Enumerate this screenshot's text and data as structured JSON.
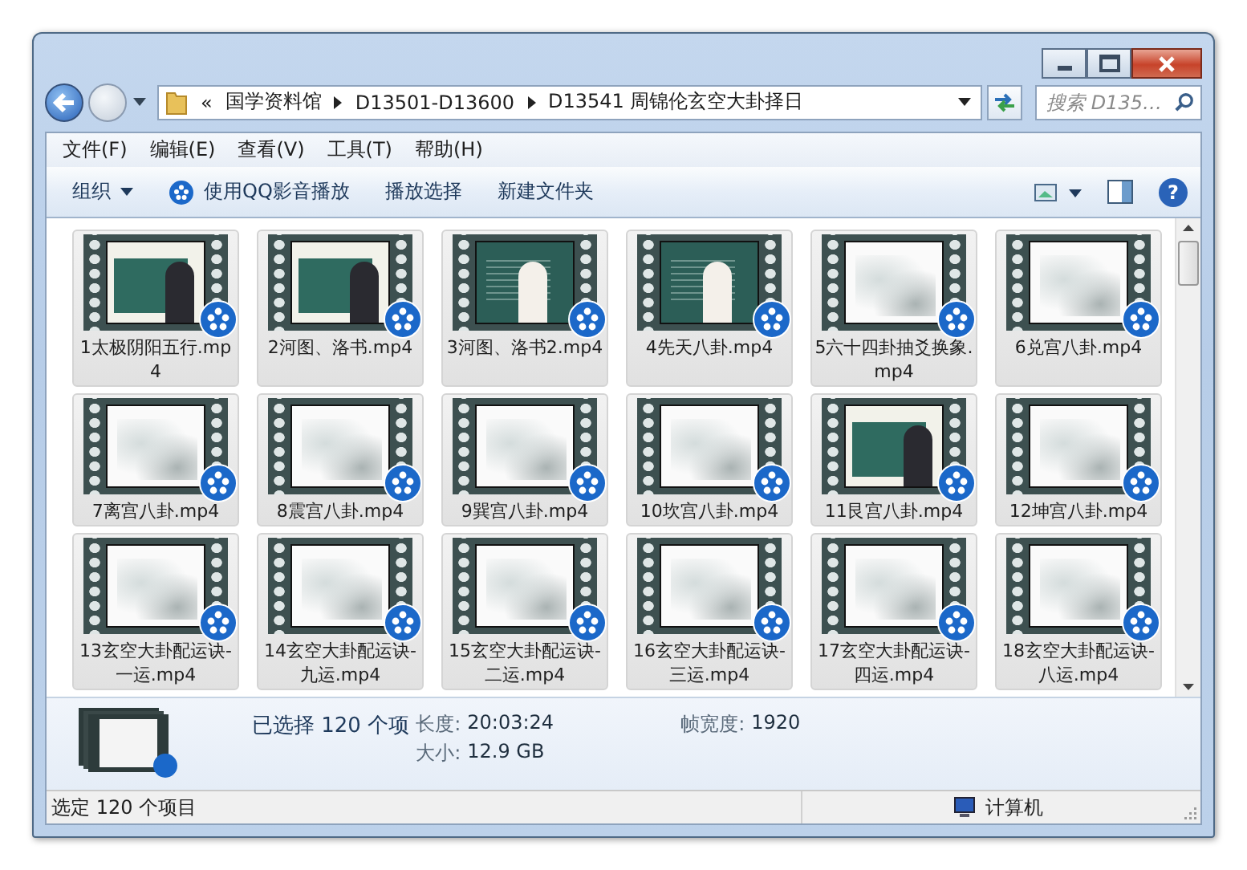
{
  "address_bar": {
    "overflow": "«",
    "path": [
      "国学资料馆",
      "D13501-D13600",
      "D13541 周锦伦玄空大卦择日"
    ]
  },
  "search": {
    "placeholder": "搜索 D135…"
  },
  "help_button": "?",
  "menu": [
    "文件(F)",
    "编辑(E)",
    "查看(V)",
    "工具(T)",
    "帮助(H)"
  ],
  "toolbar": [
    {
      "label": "组织",
      "kind": "dropdown"
    },
    {
      "label": "使用QQ影音播放",
      "kind": "player"
    },
    {
      "label": "播放选择",
      "kind": "plain"
    },
    {
      "label": "新建文件夹",
      "kind": "plain"
    }
  ],
  "files": [
    {
      "name": "1太极阴阳五行.mp4",
      "kind": "presenter",
      "selected": true
    },
    {
      "name": "2河图、洛书.mp4",
      "kind": "presenter",
      "selected": true
    },
    {
      "name": "3河图、洛书2.mp4",
      "kind": "blackboard",
      "selected": true
    },
    {
      "name": "4先天八卦.mp4",
      "kind": "blackboard",
      "selected": true
    },
    {
      "name": "5六十四卦抽爻换象.mp4",
      "kind": "ink",
      "selected": true
    },
    {
      "name": "6兑宫八卦.mp4",
      "kind": "ink",
      "selected": true
    },
    {
      "name": "7离宫八卦.mp4",
      "kind": "ink",
      "selected": true
    },
    {
      "name": "8震宫八卦.mp4",
      "kind": "ink",
      "selected": true
    },
    {
      "name": "9巽宫八卦.mp4",
      "kind": "ink",
      "selected": true
    },
    {
      "name": "10坎宫八卦.mp4",
      "kind": "ink",
      "selected": true
    },
    {
      "name": "11艮宫八卦.mp4",
      "kind": "presenter",
      "selected": true
    },
    {
      "name": "12坤宫八卦.mp4",
      "kind": "ink",
      "selected": true
    },
    {
      "name": "13玄空大卦配运诀-一运.mp4",
      "kind": "ink",
      "selected": true
    },
    {
      "name": "14玄空大卦配运诀-九运.mp4",
      "kind": "ink",
      "selected": true
    },
    {
      "name": "15玄空大卦配运诀-二运.mp4",
      "kind": "ink",
      "selected": true
    },
    {
      "name": "16玄空大卦配运诀-三运.mp4",
      "kind": "ink",
      "selected": true
    },
    {
      "name": "17玄空大卦配运诀-四运.mp4",
      "kind": "ink",
      "selected": true
    },
    {
      "name": "18玄空大卦配运诀-八运.mp4",
      "kind": "ink",
      "selected": true
    }
  ],
  "details": {
    "summary": "已选择 120 个项",
    "fields": [
      {
        "label": "长度:",
        "value": "20:03:24"
      },
      {
        "label": "大小:",
        "value": "12.9 GB"
      },
      {
        "label": "帧宽度:",
        "value": "1920"
      }
    ]
  },
  "status_bar": {
    "text": "选定 120 个项目",
    "location": "计算机"
  }
}
